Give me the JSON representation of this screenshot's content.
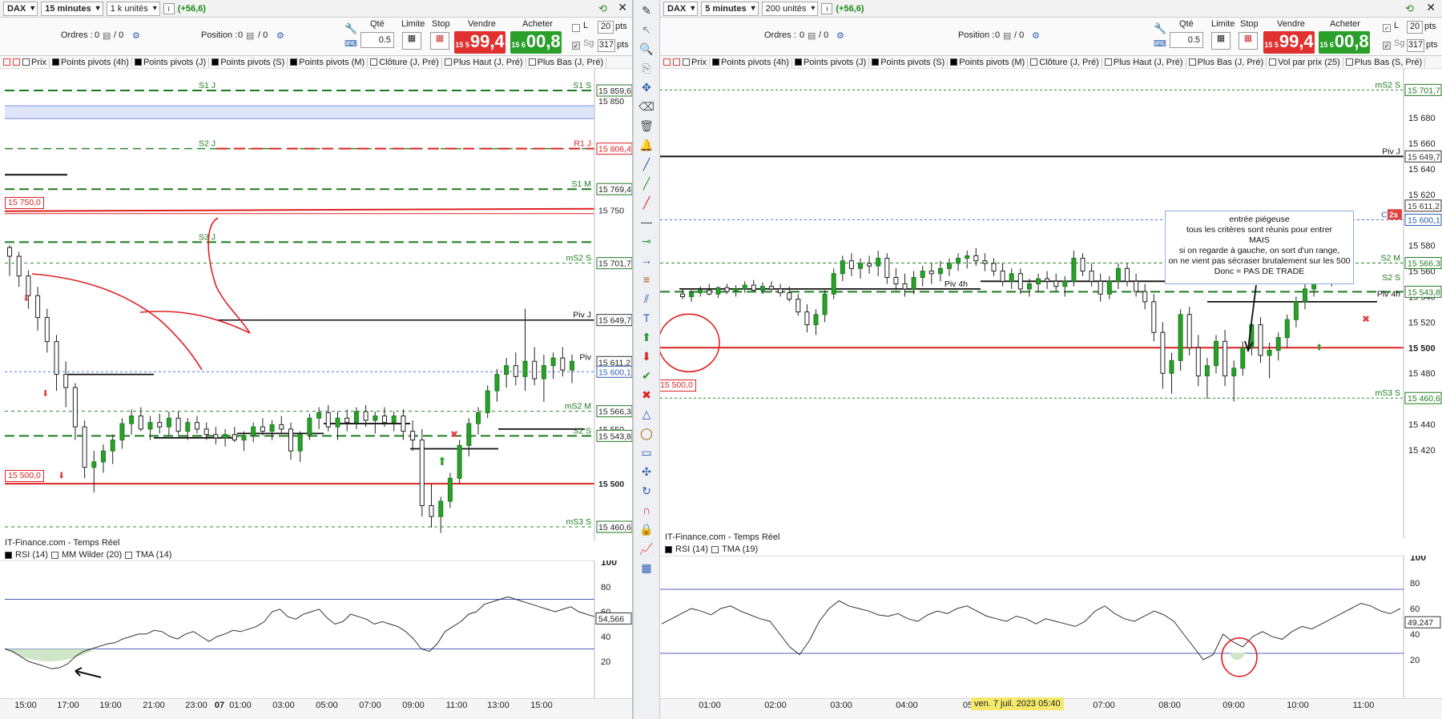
{
  "left": {
    "instrument": "DAX",
    "timeframe": "15 minutes",
    "units": "1 k unités",
    "change": "(+56,6)",
    "orders_label": "Ordres :",
    "orders_value": "0",
    "orders_value2": "/ 0",
    "position_label": "Position :",
    "position_value": "0",
    "position_value2": "/ 0",
    "qty_label": "Qté",
    "qty_value": "0.5",
    "limit_label": "Limite",
    "stop_label": "Stop",
    "sell_label": "Vendre",
    "buy_label": "Acheter",
    "sell_small": "15 5",
    "sell_big": "99,4",
    "buy_small": "15 6",
    "buy_big": "00,8",
    "pts_top": "20",
    "pts_bottom": "317",
    "pts_unit": "pts",
    "l_label": "L",
    "sg_label": "Sg",
    "indicators": [
      "Prix",
      "Points pivots (4h)",
      "Points pivots (J)",
      "Points pivots (S)",
      "Points pivots (M)",
      "Clôture (J, Pré)",
      "Plus Haut (J, Pré)",
      "Plus Bas (J, Pré)"
    ],
    "levels": [
      {
        "name": "S1 J",
        "right": "S1 S",
        "price": "15 859,6"
      },
      {
        "name": "",
        "right": "",
        "price": "15 850"
      },
      {
        "name": "S2 J",
        "right": "R1 J",
        "price": "15 806,4"
      },
      {
        "name": "",
        "right": "S1 M",
        "price": "15 769,4"
      },
      {
        "name": "",
        "right": "",
        "price": "15 750"
      },
      {
        "name": "S3 J",
        "right": "mS2 S",
        "price": "15 701,7"
      },
      {
        "name": "",
        "right": "Piv J",
        "price": "15 649,7"
      },
      {
        "name": "",
        "right": "Piv",
        "price": "15 611,2"
      },
      {
        "name": "",
        "right": "",
        "price": "15 600,1"
      },
      {
        "name": "",
        "right": "mS2 M",
        "price": "15 566,3"
      },
      {
        "name": "",
        "right": "",
        "price": "15 550"
      },
      {
        "name": "",
        "right": "S2 S",
        "price": "15 543,8"
      },
      {
        "name": "",
        "right": "",
        "price": "15 500"
      },
      {
        "name": "",
        "right": "mS3 S",
        "price": "15 460,6"
      }
    ],
    "tag_15750": "15 750,0",
    "tag_15500": "15 500,0",
    "source": "IT-Finance.com - Temps Réel",
    "sub_indicators": [
      "RSI (14)",
      "MM Wilder (20)",
      "TMA (14)"
    ],
    "rsi_ticks": [
      "100",
      "80",
      "60",
      "40",
      "20"
    ],
    "rsi_value": "54,566",
    "time_labels": [
      "15:00",
      "17:00",
      "19:00",
      "21:00",
      "23:00",
      "07",
      "01:00",
      "03:00",
      "05:00",
      "07:00",
      "09:00",
      "11:00",
      "13:00",
      "15:00"
    ],
    "ohlc": [
      [
        15716,
        15718,
        15690,
        15708
      ],
      [
        15708,
        15712,
        15680,
        15690
      ],
      [
        15690,
        15695,
        15660,
        15672
      ],
      [
        15672,
        15680,
        15640,
        15652
      ],
      [
        15652,
        15660,
        15620,
        15630
      ],
      [
        15630,
        15636,
        15585,
        15600
      ],
      [
        15600,
        15612,
        15570,
        15588
      ],
      [
        15588,
        15592,
        15540,
        15552
      ],
      [
        15552,
        15558,
        15505,
        15515
      ],
      [
        15515,
        15530,
        15492,
        15520
      ],
      [
        15520,
        15536,
        15510,
        15530
      ],
      [
        15530,
        15545,
        15518,
        15540
      ],
      [
        15540,
        15560,
        15532,
        15555
      ],
      [
        15555,
        15568,
        15545,
        15562
      ],
      [
        15562,
        15570,
        15548,
        15550
      ],
      [
        15550,
        15562,
        15540,
        15556
      ],
      [
        15556,
        15564,
        15546,
        15552
      ],
      [
        15552,
        15566,
        15544,
        15560
      ],
      [
        15560,
        15566,
        15545,
        15548
      ],
      [
        15548,
        15560,
        15540,
        15556
      ],
      [
        15556,
        15562,
        15546,
        15550
      ],
      [
        15550,
        15556,
        15540,
        15545
      ],
      [
        15545,
        15552,
        15536,
        15542
      ],
      [
        15542,
        15550,
        15534,
        15545
      ],
      [
        15545,
        15552,
        15538,
        15540
      ],
      [
        15540,
        15548,
        15530,
        15544
      ],
      [
        15544,
        15556,
        15538,
        15552
      ],
      [
        15552,
        15560,
        15544,
        15548
      ],
      [
        15548,
        15558,
        15540,
        15554
      ],
      [
        15554,
        15562,
        15546,
        15550
      ],
      [
        15550,
        15556,
        15522,
        15530
      ],
      [
        15530,
        15548,
        15520,
        15545
      ],
      [
        15545,
        15564,
        15540,
        15560
      ],
      [
        15560,
        15570,
        15550,
        15565
      ],
      [
        15565,
        15572,
        15548,
        15552
      ],
      [
        15552,
        15566,
        15540,
        15560
      ],
      [
        15560,
        15568,
        15548,
        15556
      ],
      [
        15556,
        15570,
        15550,
        15566
      ],
      [
        15566,
        15572,
        15552,
        15558
      ],
      [
        15558,
        15566,
        15546,
        15562
      ],
      [
        15562,
        15570,
        15552,
        15556
      ],
      [
        15556,
        15566,
        15548,
        15562
      ],
      [
        15562,
        15568,
        15540,
        15548
      ],
      [
        15548,
        15558,
        15530,
        15540
      ],
      [
        15540,
        15550,
        15470,
        15480
      ],
      [
        15480,
        15500,
        15460,
        15470
      ],
      [
        15470,
        15488,
        15455,
        15484
      ],
      [
        15484,
        15510,
        15478,
        15505
      ],
      [
        15505,
        15540,
        15500,
        15535
      ],
      [
        15535,
        15560,
        15525,
        15555
      ],
      [
        15555,
        15570,
        15545,
        15565
      ],
      [
        15565,
        15590,
        15560,
        15585
      ],
      [
        15585,
        15605,
        15575,
        15600
      ],
      [
        15600,
        15615,
        15588,
        15608
      ],
      [
        15608,
        15620,
        15590,
        15598
      ],
      [
        15598,
        15660,
        15585,
        15612
      ],
      [
        15612,
        15625,
        15590,
        15596
      ],
      [
        15596,
        15618,
        15575,
        15608
      ],
      [
        15608,
        15620,
        15596,
        15615
      ],
      [
        15615,
        15625,
        15598,
        15604
      ],
      [
        15604,
        15618,
        15592,
        15612
      ]
    ]
  },
  "right": {
    "instrument": "DAX",
    "timeframe": "5 minutes",
    "units": "200 unités",
    "change": "(+56,6)",
    "orders_label": "Ordres :",
    "orders_value": "0",
    "orders_value2": "/ 0",
    "position_label": "Position :",
    "position_value": "0",
    "position_value2": "/ 0",
    "qty_label": "Qté",
    "qty_value": "0.5",
    "limit_label": "Limite",
    "stop_label": "Stop",
    "sell_label": "Vendre",
    "buy_label": "Acheter",
    "sell_small": "15 5",
    "sell_big": "99,4",
    "buy_small": "15 6",
    "buy_big": "00,8",
    "pts_top": "20",
    "pts_bottom": "317",
    "pts_unit": "pts",
    "l_label": "L",
    "sg_label": "Sg",
    "indicators": [
      "Prix",
      "Points pivots (4h)",
      "Points pivots (J)",
      "Points pivots (S)",
      "Points pivots (M)",
      "Clôture (J, Pré)",
      "Plus Haut (J, Pré)",
      "Plus Bas (J, Pré)",
      "Vol par prix (25)",
      "Plus Bas (S, Pré)"
    ],
    "price_ticks": [
      "15 680",
      "15 660",
      "15 640",
      "15 620",
      "15 580",
      "15 560",
      "15 540",
      "15 520",
      "15 500",
      "15 480",
      "15 460",
      "15 440",
      "15 420"
    ],
    "price_701": "15 701,7",
    "price_649": "15 649,7",
    "price_611": "15 611,2",
    "price_600": "15 600,1",
    "price_566": "15 566,3",
    "price_543": "15 543,8",
    "price_460": "15 460,6",
    "label_ms2s": "mS2 S",
    "label_pivj": "Piv J",
    "label_cloj": "Clo J",
    "label_s2m": "S2 M",
    "label_s2s": "S2 S",
    "label_piv4h": "Piv 4h",
    "label_ms3s": "mS3 S",
    "badge_2s": "2s",
    "tag_15500": "15 500,0",
    "annotation": [
      "entrée piégeuse",
      "tous les critères sont réunis pour entrer",
      "MAIS",
      "si on regarde à gauche, on sort d'un range,",
      "on ne vient pas sécraser brutalement sur les 500",
      "Donc = PAS DE TRADE"
    ],
    "source": "IT-Finance.com - Temps Réel",
    "sub_indicators": [
      "RSI (14)",
      "TMA (19)"
    ],
    "rsi_ticks": [
      "100",
      "80",
      "60",
      "40",
      "20"
    ],
    "rsi_value": "49,247",
    "time_labels": [
      "01:00",
      "02:00",
      "03:00",
      "04:00",
      "05",
      "06:00",
      "07:00",
      "08:00",
      "09:00",
      "10:00",
      "11:00"
    ],
    "date_badge": "ven. 7 juil. 2023 05:40",
    "ohlc": [
      [
        15542,
        15546,
        15538,
        15540
      ],
      [
        15540,
        15545,
        15536,
        15543
      ],
      [
        15543,
        15548,
        15540,
        15545
      ],
      [
        15545,
        15550,
        15541,
        15542
      ],
      [
        15542,
        15548,
        15539,
        15547
      ],
      [
        15547,
        15550,
        15542,
        15544
      ],
      [
        15544,
        15549,
        15540,
        15546
      ],
      [
        15546,
        15552,
        15543,
        15549
      ],
      [
        15549,
        15553,
        15544,
        15545
      ],
      [
        15545,
        15551,
        15542,
        15548
      ],
      [
        15548,
        15552,
        15543,
        15546
      ],
      [
        15546,
        15550,
        15540,
        15543
      ],
      [
        15543,
        15548,
        15536,
        15538
      ],
      [
        15538,
        15542,
        15525,
        15528
      ],
      [
        15528,
        15534,
        15512,
        15518
      ],
      [
        15518,
        15530,
        15510,
        15526
      ],
      [
        15526,
        15545,
        15520,
        15542
      ],
      [
        15542,
        15562,
        15538,
        15558
      ],
      [
        15558,
        15572,
        15552,
        15568
      ],
      [
        15568,
        15574,
        15556,
        15562
      ],
      [
        15562,
        15570,
        15554,
        15566
      ],
      [
        15566,
        15572,
        15558,
        15564
      ],
      [
        15564,
        15576,
        15556,
        15570
      ],
      [
        15570,
        15574,
        15550,
        15555
      ],
      [
        15555,
        15562,
        15545,
        15550
      ],
      [
        15550,
        15558,
        15540,
        15546
      ],
      [
        15546,
        15560,
        15542,
        15555
      ],
      [
        15555,
        15564,
        15548,
        15560
      ],
      [
        15560,
        15566,
        15550,
        15558
      ],
      [
        15558,
        15568,
        15552,
        15562
      ],
      [
        15562,
        15570,
        15556,
        15566
      ],
      [
        15566,
        15574,
        15560,
        15570
      ],
      [
        15570,
        15576,
        15562,
        15572
      ],
      [
        15572,
        15578,
        15564,
        15568
      ],
      [
        15568,
        15574,
        15560,
        15566
      ],
      [
        15566,
        15570,
        15556,
        15560
      ],
      [
        15560,
        15566,
        15548,
        15552
      ],
      [
        15552,
        15562,
        15546,
        15558
      ],
      [
        15558,
        15562,
        15542,
        15546
      ],
      [
        15546,
        15554,
        15540,
        15550
      ],
      [
        15550,
        15558,
        15544,
        15554
      ],
      [
        15554,
        15560,
        15546,
        15552
      ],
      [
        15552,
        15558,
        15544,
        15548
      ],
      [
        15548,
        15556,
        15540,
        15552
      ],
      [
        15552,
        15576,
        15548,
        15570
      ],
      [
        15570,
        15574,
        15556,
        15560
      ],
      [
        15560,
        15566,
        15548,
        15552
      ],
      [
        15552,
        15558,
        15536,
        15542
      ],
      [
        15542,
        15556,
        15538,
        15552
      ],
      [
        15552,
        15566,
        15546,
        15562
      ],
      [
        15562,
        15566,
        15548,
        15552
      ],
      [
        15552,
        15558,
        15540,
        15544
      ],
      [
        15544,
        15550,
        15530,
        15536
      ],
      [
        15536,
        15542,
        15505,
        15512
      ],
      [
        15512,
        15520,
        15468,
        15480
      ],
      [
        15480,
        15496,
        15464,
        15490
      ],
      [
        15490,
        15530,
        15482,
        15526
      ],
      [
        15526,
        15532,
        15494,
        15500
      ],
      [
        15500,
        15510,
        15470,
        15478
      ],
      [
        15478,
        15492,
        15460,
        15486
      ],
      [
        15486,
        15510,
        15480,
        15505
      ],
      [
        15505,
        15514,
        15470,
        15478
      ],
      [
        15478,
        15490,
        15458,
        15484
      ],
      [
        15484,
        15505,
        15478,
        15500
      ],
      [
        15500,
        15522,
        15494,
        15518
      ],
      [
        15518,
        15524,
        15488,
        15494
      ],
      [
        15494,
        15504,
        15476,
        15498
      ],
      [
        15498,
        15512,
        15490,
        15508
      ],
      [
        15508,
        15526,
        15500,
        15522
      ],
      [
        15522,
        15540,
        15516,
        15536
      ],
      [
        15536,
        15550,
        15530,
        15546
      ],
      [
        15546,
        15572,
        15540,
        15568
      ],
      [
        15568,
        15574,
        15550,
        15556
      ],
      [
        15556,
        15568,
        15548,
        15564
      ]
    ]
  },
  "toolbar": {
    "icons": [
      "pen-icon",
      "cursor-icon",
      "zoom-icon",
      "copy-icon",
      "move-icon",
      "eraser-icon",
      "trash-icon",
      "alert-icon",
      "line-icon",
      "trendline-up-icon",
      "trendline-red-icon",
      "horizontal-line-icon",
      "segment-icon",
      "ray-icon",
      "fibonacci-icon",
      "channel-icon",
      "text-icon",
      "arrow-up-icon",
      "arrow-down-icon",
      "check-icon",
      "cross-icon",
      "triangle-icon",
      "ellipse-icon",
      "rectangle-icon",
      "network-icon",
      "cycle-icon",
      "magnet-icon",
      "lock-icon",
      "chart-icon",
      "pattern-icon"
    ]
  }
}
